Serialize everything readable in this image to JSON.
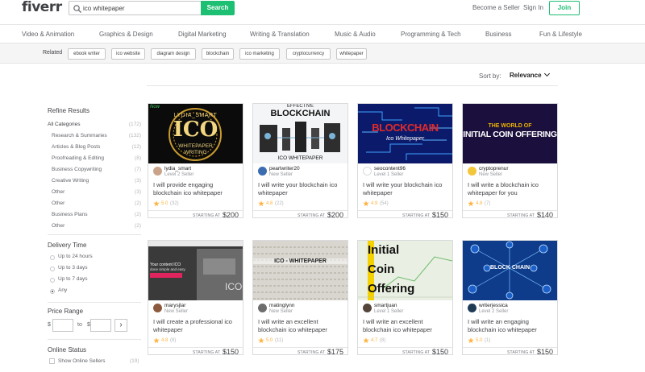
{
  "header": {
    "logo": "fiverr",
    "search_value": "ico whitepaper",
    "search_button": "Search",
    "become_seller": "Become a Seller",
    "sign_in": "Sign In",
    "join": "Join"
  },
  "categories": [
    "Video & Animation",
    "Graphics & Design",
    "Digital Marketing",
    "Writing & Translation",
    "Music & Audio",
    "Programming & Tech",
    "Business",
    "Fun & Lifestyle"
  ],
  "related": {
    "label": "Related",
    "tags": [
      "ebook writer",
      "ico website",
      "diagram design",
      "blockchain",
      "ico marketing",
      "cryptocurrency",
      "whitepaper"
    ]
  },
  "sort": {
    "label": "Sort by:",
    "value": "Relevance"
  },
  "sidebar": {
    "refine_title": "Refine Results",
    "all_categories": {
      "label": "All Categories",
      "count": "(172)"
    },
    "subcategories": [
      {
        "label": "Research & Summaries",
        "count": "(132)"
      },
      {
        "label": "Articles & Blog Posts",
        "count": "(12)"
      },
      {
        "label": "Proofreading & Editing",
        "count": "(8)"
      },
      {
        "label": "Business Copywriting",
        "count": "(7)"
      },
      {
        "label": "Creative Writing",
        "count": "(3)"
      },
      {
        "label": "Other",
        "count": "(3)"
      },
      {
        "label": "Other",
        "count": "(2)"
      },
      {
        "label": "Business Plans",
        "count": "(2)"
      },
      {
        "label": "Other",
        "count": "(2)"
      }
    ],
    "delivery_title": "Delivery Time",
    "delivery_options": [
      "Up to 24 hours",
      "Up to 3 days",
      "Up to 7 days",
      "Any"
    ],
    "delivery_selected": "Any",
    "price_title": "Price Range",
    "price_currency": "$",
    "price_to": "to",
    "price_currency2": "$",
    "price_go": "›",
    "online_title": "Online Status",
    "online_label": "Show Online Sellers",
    "online_count": "(19)"
  },
  "gigs": [
    {
      "seller": "lydia_smart",
      "level": "Level 2 Seller",
      "title": "I will provide engaging blockchain ico whitepaper",
      "rating": "5.0",
      "reviews": "(32)",
      "starting": "STARTING AT",
      "price": "$200",
      "image_text": [
        "Now",
        "LYDIA_SMART",
        "ICO",
        "WHITEPAPER",
        "WRITING"
      ]
    },
    {
      "seller": "pearlwriter20",
      "level": "New Seller",
      "title": "I will write your blockchain ico whitepaper",
      "rating": "4.8",
      "reviews": "(22)",
      "starting": "STARTING AT",
      "price": "$200",
      "image_text": [
        "EFFECTIVE",
        "BLOCKCHAIN",
        "ICO WHITEPAPER"
      ]
    },
    {
      "seller": "seocontent96",
      "level": "Level 1 Seller",
      "title": "I will write your blockchain ico whitepaper",
      "rating": "4.9",
      "reviews": "(54)",
      "starting": "STARTING AT",
      "price": "$150",
      "image_text": [
        "BLOCKCHAIN",
        "Ico Whitepaper"
      ]
    },
    {
      "seller": "cryptoprenur",
      "level": "New Seller",
      "title": "I will write a blockchain ico whitepaper for you",
      "rating": "4.8",
      "reviews": "(7)",
      "starting": "STARTING AT",
      "price": "$140",
      "image_text": [
        "THE WORLD OF",
        "INITIAL COIN OFFERING"
      ]
    },
    {
      "seller": "marysjlar",
      "level": "New Seller",
      "title": "I will create a professional ico whitepaper",
      "rating": "4.8",
      "reviews": "(8)",
      "starting": "STARTING AT",
      "price": "$150",
      "image_text": [
        "Your content ICO",
        "done simple and easy",
        "ICO"
      ]
    },
    {
      "seller": "matinglynn",
      "level": "New Seller",
      "title": "I will write an excellent blockchain ico whitepaper",
      "rating": "5.0",
      "reviews": "(11)",
      "starting": "STARTING AT",
      "price": "$175",
      "image_text": [
        "ICO - WHITEPAPER"
      ]
    },
    {
      "seller": "smartjuan",
      "level": "Level 1 Seller",
      "title": "I will write an excellent blockchain ico whitepaper",
      "rating": "4.7",
      "reviews": "(8)",
      "starting": "STARTING AT",
      "price": "$150",
      "image_text": [
        "Initial",
        "Coin",
        "Offering"
      ]
    },
    {
      "seller": "writerjessica",
      "level": "Level 2 Seller",
      "title": "I will write an engaging blockchain ico whitepaper",
      "rating": "5.0",
      "reviews": "(1)",
      "starting": "STARTING AT",
      "price": "$150",
      "image_text": [
        "BLOCK CHAIN"
      ]
    }
  ],
  "colors": {
    "brand_green": "#1dbf73",
    "star": "#ffb33e",
    "text": "#404145",
    "muted": "#95979d"
  }
}
